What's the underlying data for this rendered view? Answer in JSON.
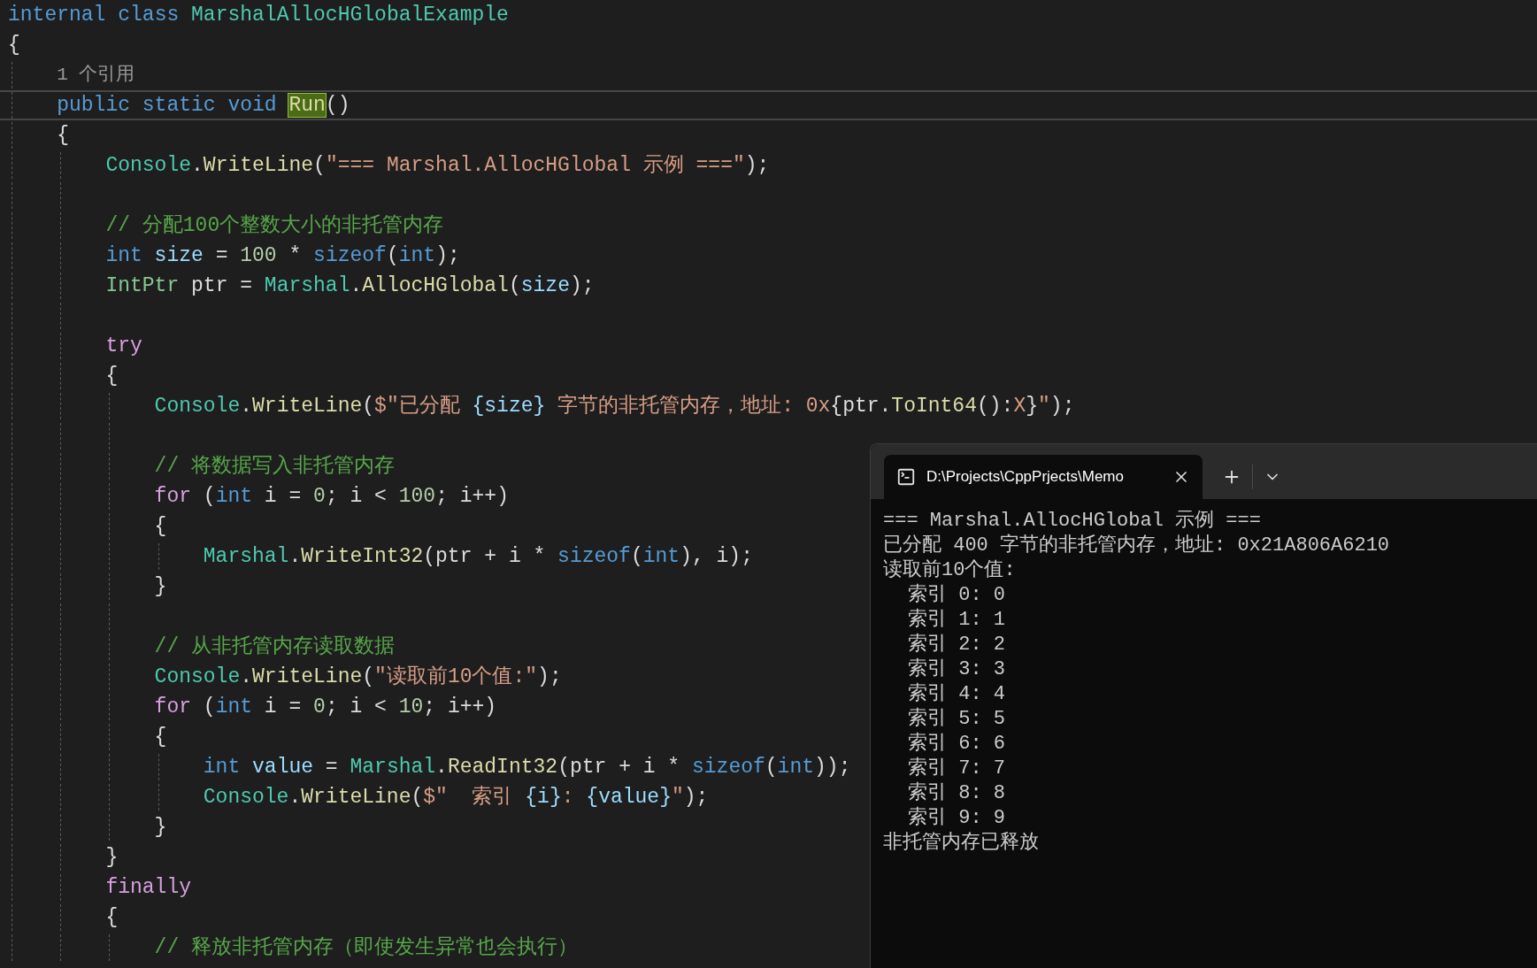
{
  "editor": {
    "lines": [
      {
        "kind": "code",
        "current": false,
        "tokens": [
          {
            "text": "internal class ",
            "kind": "kw"
          },
          {
            "text": "MarshalAllocHGlobalExample",
            "kind": "type"
          }
        ]
      },
      {
        "kind": "code",
        "current": false,
        "tokens": [
          {
            "text": "{",
            "kind": "plain"
          }
        ]
      },
      {
        "kind": "codelens",
        "current": false,
        "tokens": [
          {
            "text": "    1 个引用",
            "kind": "lens"
          }
        ]
      },
      {
        "kind": "code",
        "current": true,
        "tokens": [
          {
            "text": "    public static void ",
            "kind": "kw"
          },
          {
            "text": "Run",
            "kind": "match"
          },
          {
            "text": "()",
            "kind": "plain"
          }
        ]
      },
      {
        "kind": "code",
        "current": false,
        "tokens": [
          {
            "text": "    {",
            "kind": "plain"
          }
        ]
      },
      {
        "kind": "code",
        "current": false,
        "tokens": [
          {
            "text": "        Console",
            "kind": "type"
          },
          {
            "text": ".",
            "kind": "plain"
          },
          {
            "text": "WriteLine",
            "kind": "method"
          },
          {
            "text": "(",
            "kind": "plain"
          },
          {
            "text": "\"=== Marshal.AllocHGlobal 示例 ===\"",
            "kind": "str"
          },
          {
            "text": ");",
            "kind": "plain"
          }
        ]
      },
      {
        "kind": "blank",
        "current": false
      },
      {
        "kind": "code",
        "current": false,
        "tokens": [
          {
            "text": "        // 分配100个整数大小的非托管内存",
            "kind": "comment"
          }
        ]
      },
      {
        "kind": "code",
        "current": false,
        "tokens": [
          {
            "text": "        int",
            "kind": "kw"
          },
          {
            "text": " size",
            "kind": "var"
          },
          {
            "text": " = ",
            "kind": "plain"
          },
          {
            "text": "100",
            "kind": "num"
          },
          {
            "text": " * ",
            "kind": "plain"
          },
          {
            "text": "sizeof",
            "kind": "kw"
          },
          {
            "text": "(",
            "kind": "plain"
          },
          {
            "text": "int",
            "kind": "kw"
          },
          {
            "text": ");",
            "kind": "plain"
          }
        ]
      },
      {
        "kind": "code",
        "current": false,
        "tokens": [
          {
            "text": "        IntPtr",
            "kind": "struct"
          },
          {
            "text": " ptr = ",
            "kind": "plain"
          },
          {
            "text": "Marshal",
            "kind": "type"
          },
          {
            "text": ".",
            "kind": "plain"
          },
          {
            "text": "AllocHGlobal",
            "kind": "method"
          },
          {
            "text": "(",
            "kind": "plain"
          },
          {
            "text": "size",
            "kind": "var"
          },
          {
            "text": ");",
            "kind": "plain"
          }
        ]
      },
      {
        "kind": "blank",
        "current": false
      },
      {
        "kind": "code",
        "current": false,
        "tokens": [
          {
            "text": "        try",
            "kind": "ctrl"
          }
        ]
      },
      {
        "kind": "code",
        "current": false,
        "tokens": [
          {
            "text": "        {",
            "kind": "plain"
          }
        ]
      },
      {
        "kind": "code",
        "current": false,
        "tokens": [
          {
            "text": "            Console",
            "kind": "type"
          },
          {
            "text": ".",
            "kind": "plain"
          },
          {
            "text": "WriteLine",
            "kind": "method"
          },
          {
            "text": "(",
            "kind": "plain"
          },
          {
            "text": "$\"已分配 ",
            "kind": "str"
          },
          {
            "text": "{size}",
            "kind": "var"
          },
          {
            "text": " 字节的非托管内存，地址: 0x",
            "kind": "str"
          },
          {
            "text": "{ptr.",
            "kind": "plain"
          },
          {
            "text": "ToInt64",
            "kind": "method"
          },
          {
            "text": "():",
            "kind": "plain"
          },
          {
            "text": "X",
            "kind": "str"
          },
          {
            "text": "}",
            "kind": "plain"
          },
          {
            "text": "\"",
            "kind": "str"
          },
          {
            "text": ");",
            "kind": "plain"
          }
        ]
      },
      {
        "kind": "blank",
        "current": false
      },
      {
        "kind": "code",
        "current": false,
        "tokens": [
          {
            "text": "            // 将数据写入非托管内存",
            "kind": "comment"
          }
        ]
      },
      {
        "kind": "code",
        "current": false,
        "tokens": [
          {
            "text": "            for",
            "kind": "ctrl"
          },
          {
            "text": " (",
            "kind": "plain"
          },
          {
            "text": "int",
            "kind": "kw"
          },
          {
            "text": " i = ",
            "kind": "plain"
          },
          {
            "text": "0",
            "kind": "num"
          },
          {
            "text": "; i < ",
            "kind": "plain"
          },
          {
            "text": "100",
            "kind": "num"
          },
          {
            "text": "; i++)",
            "kind": "plain"
          }
        ]
      },
      {
        "kind": "code",
        "current": false,
        "tokens": [
          {
            "text": "            {",
            "kind": "plain"
          }
        ]
      },
      {
        "kind": "code",
        "current": false,
        "tokens": [
          {
            "text": "                Marshal",
            "kind": "type"
          },
          {
            "text": ".",
            "kind": "plain"
          },
          {
            "text": "WriteInt32",
            "kind": "method"
          },
          {
            "text": "(ptr + i * ",
            "kind": "plain"
          },
          {
            "text": "sizeof",
            "kind": "kw"
          },
          {
            "text": "(",
            "kind": "plain"
          },
          {
            "text": "int",
            "kind": "kw"
          },
          {
            "text": "), i);",
            "kind": "plain"
          }
        ]
      },
      {
        "kind": "code",
        "current": false,
        "tokens": [
          {
            "text": "            }",
            "kind": "plain"
          }
        ]
      },
      {
        "kind": "blank",
        "current": false
      },
      {
        "kind": "code",
        "current": false,
        "tokens": [
          {
            "text": "            // 从非托管内存读取数据",
            "kind": "comment"
          }
        ]
      },
      {
        "kind": "code",
        "current": false,
        "tokens": [
          {
            "text": "            Console",
            "kind": "type"
          },
          {
            "text": ".",
            "kind": "plain"
          },
          {
            "text": "WriteLine",
            "kind": "method"
          },
          {
            "text": "(",
            "kind": "plain"
          },
          {
            "text": "\"读取前10个值:\"",
            "kind": "str"
          },
          {
            "text": ");",
            "kind": "plain"
          }
        ]
      },
      {
        "kind": "code",
        "current": false,
        "tokens": [
          {
            "text": "            for",
            "kind": "ctrl"
          },
          {
            "text": " (",
            "kind": "plain"
          },
          {
            "text": "int",
            "kind": "kw"
          },
          {
            "text": " i = ",
            "kind": "plain"
          },
          {
            "text": "0",
            "kind": "num"
          },
          {
            "text": "; i < ",
            "kind": "plain"
          },
          {
            "text": "10",
            "kind": "num"
          },
          {
            "text": "; i++)",
            "kind": "plain"
          }
        ]
      },
      {
        "kind": "code",
        "current": false,
        "tokens": [
          {
            "text": "            {",
            "kind": "plain"
          }
        ]
      },
      {
        "kind": "code",
        "current": false,
        "tokens": [
          {
            "text": "                int",
            "kind": "kw"
          },
          {
            "text": " value",
            "kind": "var"
          },
          {
            "text": " = ",
            "kind": "plain"
          },
          {
            "text": "Marshal",
            "kind": "type"
          },
          {
            "text": ".",
            "kind": "plain"
          },
          {
            "text": "ReadInt32",
            "kind": "method"
          },
          {
            "text": "(ptr + i * ",
            "kind": "plain"
          },
          {
            "text": "sizeof",
            "kind": "kw"
          },
          {
            "text": "(",
            "kind": "plain"
          },
          {
            "text": "int",
            "kind": "kw"
          },
          {
            "text": "));",
            "kind": "plain"
          }
        ]
      },
      {
        "kind": "code",
        "current": false,
        "tokens": [
          {
            "text": "                Console",
            "kind": "type"
          },
          {
            "text": ".",
            "kind": "plain"
          },
          {
            "text": "WriteLine",
            "kind": "method"
          },
          {
            "text": "(",
            "kind": "plain"
          },
          {
            "text": "$\"  索引 ",
            "kind": "str"
          },
          {
            "text": "{i}",
            "kind": "var"
          },
          {
            "text": ": ",
            "kind": "str"
          },
          {
            "text": "{value}",
            "kind": "var"
          },
          {
            "text": "\"",
            "kind": "str"
          },
          {
            "text": ");",
            "kind": "plain"
          }
        ]
      },
      {
        "kind": "code",
        "current": false,
        "tokens": [
          {
            "text": "            }",
            "kind": "plain"
          }
        ]
      },
      {
        "kind": "code",
        "current": false,
        "tokens": [
          {
            "text": "        }",
            "kind": "plain"
          }
        ]
      },
      {
        "kind": "code",
        "current": false,
        "tokens": [
          {
            "text": "        finally",
            "kind": "ctrl"
          }
        ]
      },
      {
        "kind": "code",
        "current": false,
        "tokens": [
          {
            "text": "        {",
            "kind": "plain"
          }
        ]
      },
      {
        "kind": "code",
        "current": false,
        "tokens": [
          {
            "text": "            // 释放非托管内存（即使发生异常也会执行）",
            "kind": "comment"
          }
        ]
      }
    ]
  },
  "terminal": {
    "tab": {
      "title": "D:\\Projects\\CppPrjects\\Memo",
      "selected": true
    },
    "output": [
      "=== Marshal.AllocHGlobal 示例 ===",
      "已分配 400 字节的非托管内存，地址: 0x21A806A6210",
      "读取前10个值:",
      "  索引 0: 0",
      "  索引 1: 1",
      "  索引 2: 2",
      "  索引 3: 3",
      "  索引 4: 4",
      "  索引 5: 5",
      "  索引 6: 6",
      "  索引 7: 7",
      "  索引 8: 8",
      "  索引 9: 9",
      "非托管内存已释放"
    ]
  }
}
